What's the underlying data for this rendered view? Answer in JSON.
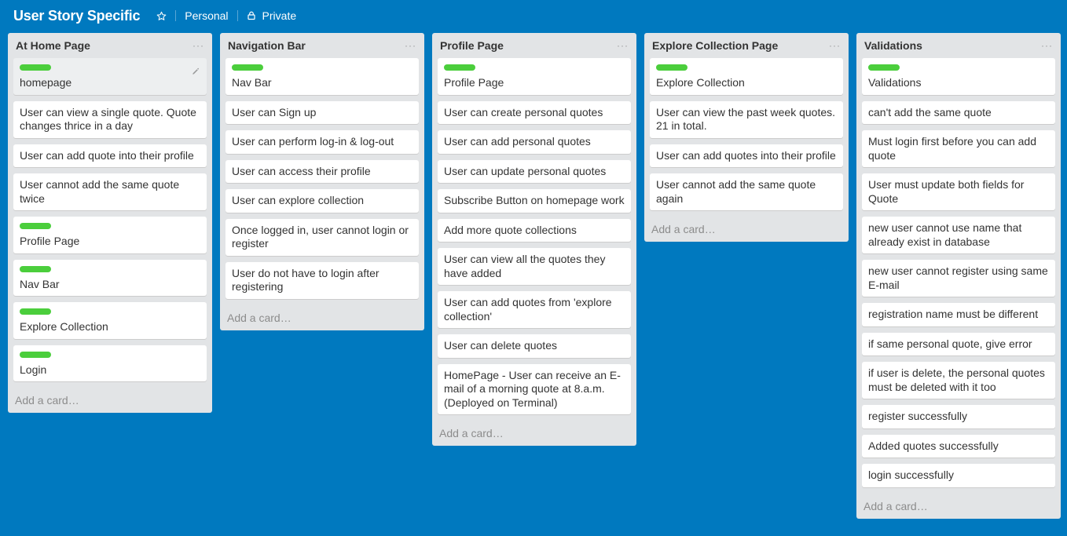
{
  "board": {
    "title": "User Story Specific",
    "team": "Personal",
    "visibility": "Private"
  },
  "add_card_label": "Add a card…",
  "lists": [
    {
      "title": "At Home Page",
      "cards": [
        {
          "text": "homepage",
          "label": true
        },
        {
          "text": "User can view a single quote. Quote changes thrice in a day",
          "label": false
        },
        {
          "text": "User can add quote into their profile",
          "label": false
        },
        {
          "text": "User cannot add the same quote twice",
          "label": false
        },
        {
          "text": "Profile Page",
          "label": true
        },
        {
          "text": "Nav Bar",
          "label": true
        },
        {
          "text": "Explore Collection",
          "label": true
        },
        {
          "text": "Login",
          "label": true
        }
      ]
    },
    {
      "title": "Navigation Bar",
      "cards": [
        {
          "text": "Nav Bar",
          "label": true
        },
        {
          "text": "User can Sign up",
          "label": false
        },
        {
          "text": "User can perform log-in & log-out",
          "label": false
        },
        {
          "text": "User can access their profile",
          "label": false
        },
        {
          "text": "User can explore collection",
          "label": false
        },
        {
          "text": "Once logged in, user cannot login or register",
          "label": false
        },
        {
          "text": "User do not have to login after registering",
          "label": false
        }
      ]
    },
    {
      "title": "Profile Page",
      "cards": [
        {
          "text": "Profile Page",
          "label": true
        },
        {
          "text": "User can create personal quotes",
          "label": false
        },
        {
          "text": "User can add personal quotes",
          "label": false
        },
        {
          "text": "User can update personal quotes",
          "label": false
        },
        {
          "text": "Subscribe Button on homepage work",
          "label": false
        },
        {
          "text": "Add more quote collections",
          "label": false
        },
        {
          "text": "User can view all the quotes they have added",
          "label": false
        },
        {
          "text": "User can add quotes from 'explore collection'",
          "label": false
        },
        {
          "text": "User can delete quotes",
          "label": false
        },
        {
          "text": "HomePage - User can receive an E-mail of a morning quote at 8.a.m. (Deployed on Terminal)",
          "label": false
        }
      ]
    },
    {
      "title": "Explore Collection Page",
      "cards": [
        {
          "text": "Explore Collection",
          "label": true
        },
        {
          "text": "User can view the past week quotes. 21 in total.",
          "label": false
        },
        {
          "text": "User can add quotes into their profile",
          "label": false
        },
        {
          "text": "User cannot add the same quote again",
          "label": false
        }
      ]
    },
    {
      "title": "Validations",
      "cards": [
        {
          "text": "Validations",
          "label": true
        },
        {
          "text": "can't add the same quote",
          "label": false
        },
        {
          "text": "Must login first before you can add quote",
          "label": false
        },
        {
          "text": "User must update both fields for Quote",
          "label": false
        },
        {
          "text": "new user cannot use name that already exist in database",
          "label": false
        },
        {
          "text": "new user cannot register using same E-mail",
          "label": false
        },
        {
          "text": "registration name must be different",
          "label": false
        },
        {
          "text": "if same personal quote, give error",
          "label": false
        },
        {
          "text": "if user is delete, the personal quotes must be deleted with it too",
          "label": false
        },
        {
          "text": "register successfully",
          "label": false
        },
        {
          "text": "Added quotes successfully",
          "label": false
        },
        {
          "text": "login successfully",
          "label": false
        }
      ]
    }
  ],
  "colors": {
    "board_background": "#0079bf",
    "list_background": "#e2e4e6",
    "label_green": "#4bce3c"
  },
  "icons": {
    "star": "star-icon",
    "lock": "lock-icon",
    "edit": "pencil-icon",
    "list_menu": "ellipsis-icon"
  }
}
